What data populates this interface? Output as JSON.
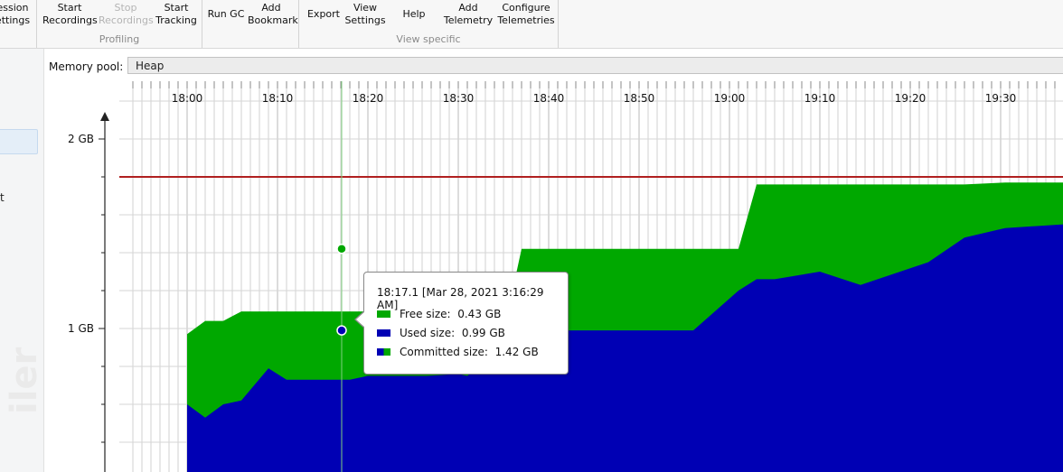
{
  "toolbar": {
    "session_group": {
      "button": "ession\nettings"
    },
    "profiling_group": {
      "label": "Profiling",
      "buttons": [
        {
          "label": "Start\nRecordings",
          "disabled": false
        },
        {
          "label": "Stop\nRecordings",
          "disabled": true
        },
        {
          "label": "Start\nTracking",
          "disabled": false
        }
      ]
    },
    "gc_group": {
      "buttons": [
        {
          "label": "Run GC"
        },
        {
          "label": "Add\nBookmark"
        }
      ]
    },
    "view_specific_group": {
      "label": "View specific",
      "buttons": [
        {
          "label": "Export"
        },
        {
          "label": "View\nSettings"
        },
        {
          "label": "Help"
        },
        {
          "label": "Add\nTelemetry"
        },
        {
          "label": "Configure\nTelemetries"
        }
      ]
    }
  },
  "sidebar": {
    "partial_text": "t",
    "watermark": "iler"
  },
  "memory_pool": {
    "label": "Memory pool:",
    "selected": "Heap"
  },
  "chart_data": {
    "type": "area",
    "title": "",
    "x_tick_labels": [
      "18:00",
      "18:10",
      "18:20",
      "18:30",
      "18:40",
      "18:50",
      "19:00",
      "19:10",
      "19:20",
      "19:30"
    ],
    "y_tick_labels": [
      "2 GB",
      "1 GB"
    ],
    "ylim": [
      0.4,
      2.1
    ],
    "max_line_gb": 1.8,
    "grid": true,
    "x_minutes": [
      0,
      2,
      4,
      6,
      9,
      11,
      15,
      18,
      20,
      22.5,
      26.5,
      30,
      31,
      33,
      35,
      35.5,
      37,
      38.7,
      40,
      45,
      48,
      56,
      61,
      63,
      65,
      70,
      74.5,
      82,
      86,
      90.5,
      97,
      103.5
    ],
    "series": [
      {
        "name": "Used size",
        "color": "#0000b4",
        "values": [
          0.6,
          0.53,
          0.6,
          0.62,
          0.79,
          0.73,
          0.73,
          0.73,
          0.75,
          0.75,
          0.75,
          0.76,
          0.75,
          0.82,
          0.78,
          0.86,
          0.96,
          0.92,
          0.99,
          0.99,
          0.99,
          0.99,
          1.2,
          1.26,
          1.26,
          1.3,
          1.23,
          1.35,
          1.48,
          1.53,
          1.55,
          1.57
        ]
      },
      {
        "name": "Committed size",
        "color": "#00a800",
        "values": [
          0.97,
          1.04,
          1.04,
          1.09,
          1.09,
          1.09,
          1.09,
          1.09,
          1.09,
          1.09,
          1.09,
          1.09,
          1.09,
          1.09,
          1.09,
          1.09,
          1.42,
          1.42,
          1.42,
          1.42,
          1.42,
          1.42,
          1.42,
          1.76,
          1.76,
          1.76,
          1.76,
          1.76,
          1.76,
          1.77,
          1.77,
          1.77
        ]
      }
    ],
    "cursor_minute": 17.1
  },
  "tooltip": {
    "title": "18:17.1 [Mar 28, 2021 3:16:29 AM]",
    "rows": [
      {
        "label": "Free size:",
        "value": "0.43 GB",
        "swatch": "free"
      },
      {
        "label": "Used size:",
        "value": "0.99 GB",
        "swatch": "used"
      },
      {
        "label": "Committed size:",
        "value": "1.42 GB",
        "swatch": "committed"
      }
    ],
    "colors": {
      "free": "#00a800",
      "used": "#0000b4",
      "max_line": "#b02020"
    }
  }
}
